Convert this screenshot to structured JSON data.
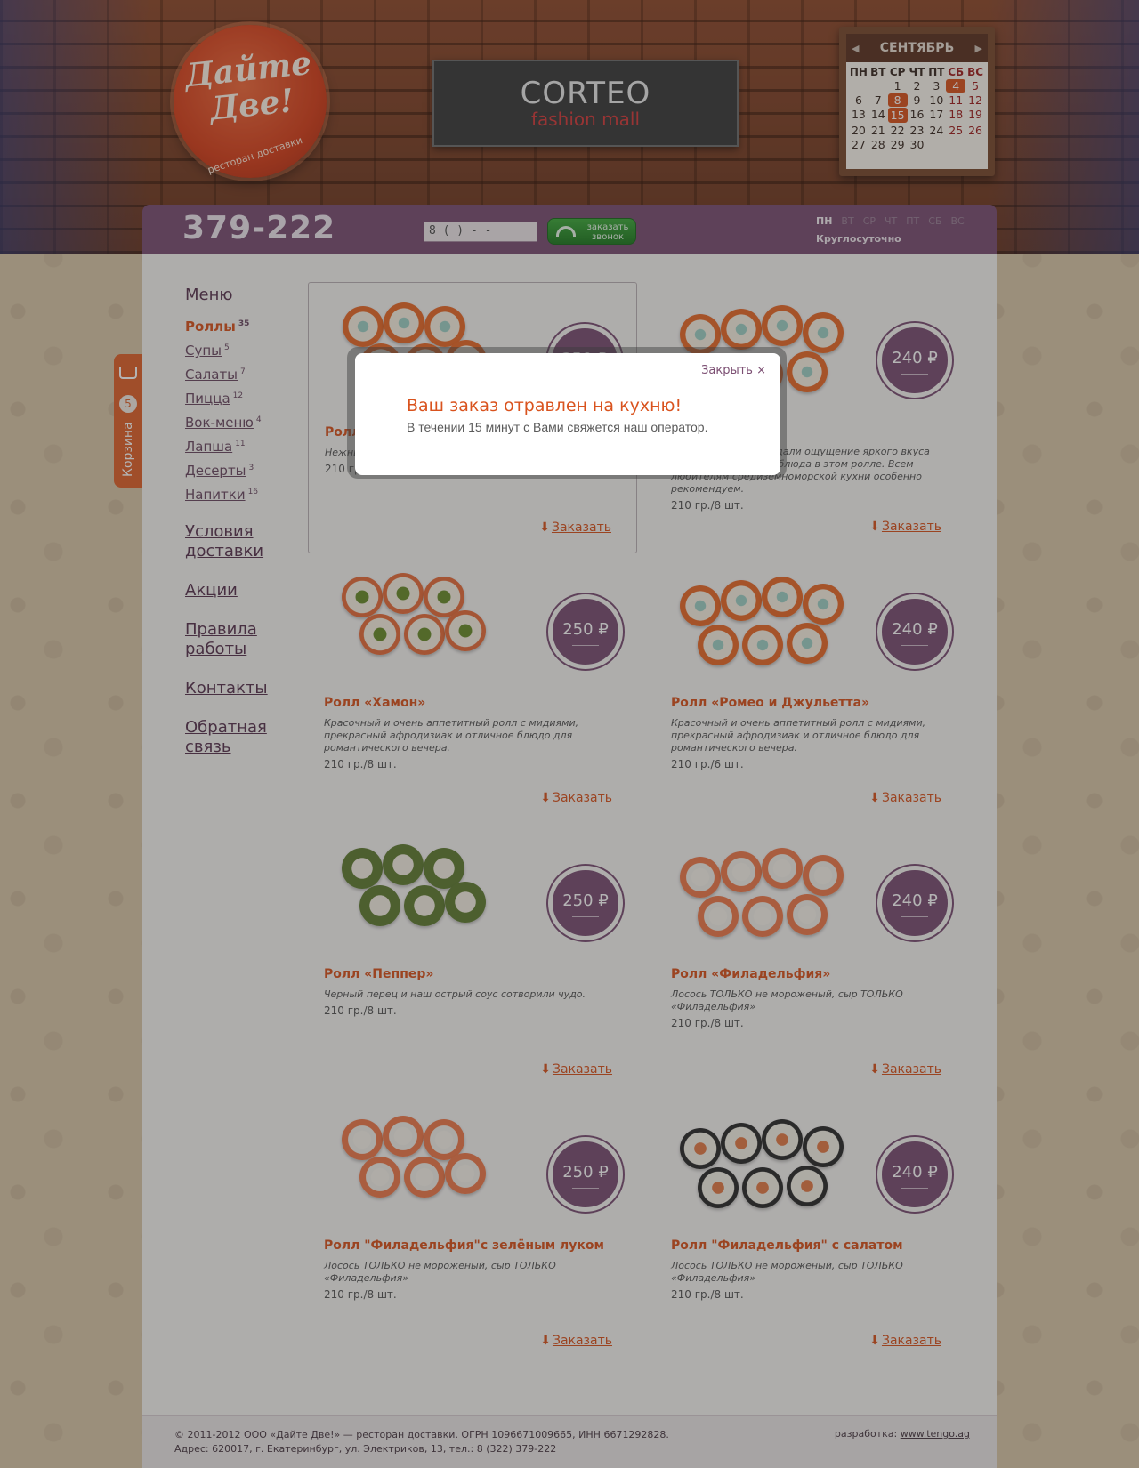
{
  "colors": {
    "accent": "#d9531e",
    "brand_purple": "#7c4f73",
    "price_badge": "#7b4f74"
  },
  "header": {
    "logo": {
      "title": "Дайте\nДве!",
      "subtitle": "ресторан доставки"
    },
    "banner": {
      "brand": "CORTEO",
      "sub": "fashion mall"
    },
    "calendar": {
      "month": "СЕНТЯБРЬ",
      "day_names": [
        "ПН",
        "ВТ",
        "СР",
        "ЧТ",
        "ПТ",
        "СБ",
        "ВС"
      ],
      "rows": [
        [
          "",
          "",
          "1",
          "2",
          "3",
          "4",
          "5"
        ],
        [
          "6",
          "7",
          "8",
          "9",
          "10",
          "11",
          "12"
        ],
        [
          "13",
          "14",
          "15",
          "16",
          "17",
          "18",
          "19"
        ],
        [
          "20",
          "21",
          "22",
          "23",
          "24",
          "25",
          "26"
        ],
        [
          "27",
          "28",
          "29",
          "30",
          "",
          "",
          ""
        ]
      ],
      "marked": [
        "4",
        "8"
      ],
      "today": "15"
    }
  },
  "topbar": {
    "phone": "379-222",
    "callback_placeholder": "8 (    )     -   -",
    "callback_button": "заказать\nзвонок",
    "days": [
      "ПН",
      "ВТ",
      "СР",
      "ЧТ",
      "ПТ",
      "СБ",
      "ВС"
    ],
    "hours": "Круглосуточно"
  },
  "sidenav": {
    "heading": "Меню",
    "items": [
      {
        "label": "Роллы",
        "count": "35",
        "active": true
      },
      {
        "label": "Супы",
        "count": "5"
      },
      {
        "label": "Салаты",
        "count": "7"
      },
      {
        "label": "Пицца",
        "count": "12"
      },
      {
        "label": "Вок-меню",
        "count": "4"
      },
      {
        "label": "Лапша",
        "count": "11"
      },
      {
        "label": "Десерты",
        "count": "3"
      },
      {
        "label": "Напитки",
        "count": "16"
      }
    ],
    "links": [
      "Условия\nдоставки",
      "Акции",
      "Правила\nработы",
      "Контакты",
      "Обратная\nсвязь"
    ]
  },
  "products": [
    {
      "title": "Ролл",
      "desc": "Нежны                                                 которую вы                  из известе.",
      "weight": "210 гр./8 шт.",
      "price": "250 ₽",
      "order": "Заказать",
      "style": "spotted"
    },
    {
      "title": "                   день»",
      "desc": "                          пряные каперсы создали ощущение яркого вкуса почти итальянского блюда в этом ролле. Всем любителям средиземноморской кухни особенно рекомендуем.",
      "weight": "210 гр./8 шт.",
      "price": "240 ₽",
      "order": "Заказать",
      "style": "spotted"
    },
    {
      "title": "Ролл «Хамон»",
      "desc": "Красочный и очень аппетитный ролл с мидиями, прекрасный афродизиак и отличное блюдо для романтического вечера.",
      "weight": "210 гр./8 шт.",
      "price": "250 ₽",
      "order": "Заказать",
      "style": "roll"
    },
    {
      "title": "Ролл «Ромео и Джульетта»",
      "desc": "Красочный и очень аппетитный ролл с мидиями, прекрасный афродизиак и отличное блюдо для романтического вечера.",
      "weight": "210 гр./6 шт.",
      "price": "240 ₽",
      "order": "Заказать",
      "style": "spotted"
    },
    {
      "title": "Ролл «Пеппер»",
      "desc": "Черный перец и наш острый соус сотворили чудо.",
      "weight": "210 гр./8 шт.",
      "price": "250 ₽",
      "order": "Заказать",
      "style": "green"
    },
    {
      "title": "Ролл «Филадельфия»",
      "desc": "Лосось ТОЛЬКО не мороженый, сыр ТОЛЬКО «Филадельфия»",
      "weight": "210 гр./8 шт.",
      "price": "240 ₽",
      "order": "Заказать",
      "style": "salmon"
    },
    {
      "title": "Ролл \"Филадельфия\"с зелёным луком",
      "desc": "Лосось ТОЛЬКО не мороженый, сыр ТОЛЬКО «Филадельфия»",
      "weight": "210 гр./8 шт.",
      "price": "250 ₽",
      "order": "Заказать",
      "style": "salmon"
    },
    {
      "title": "Ролл \"Филадельфия\" с салатом",
      "desc": "Лосось ТОЛЬКО не мороженый, сыр ТОЛЬКО «Филадельфия»",
      "weight": "210 гр./8 шт.",
      "price": "240 ₽",
      "order": "Заказать",
      "style": "dark"
    }
  ],
  "cart": {
    "label": "Корзина",
    "count": "5"
  },
  "footer": {
    "copyright": "© 2011-2012 ООО «Дайте Две!» — ресторан доставки. ОГРН 1096671009665, ИНН 6671292828.",
    "address": "Адрес: 620017, г. Екатеринбург, ул. Электриков, 13, тел.: 8 (322) 379-222",
    "dev_label": "разработка:",
    "dev_link": "www.tengo.ag"
  },
  "modal": {
    "close": "Закрыть ×",
    "title": "Ваш заказ отравлен на кухню!",
    "text": "В течении 15 минут с Вами свяжется наш оператор."
  }
}
